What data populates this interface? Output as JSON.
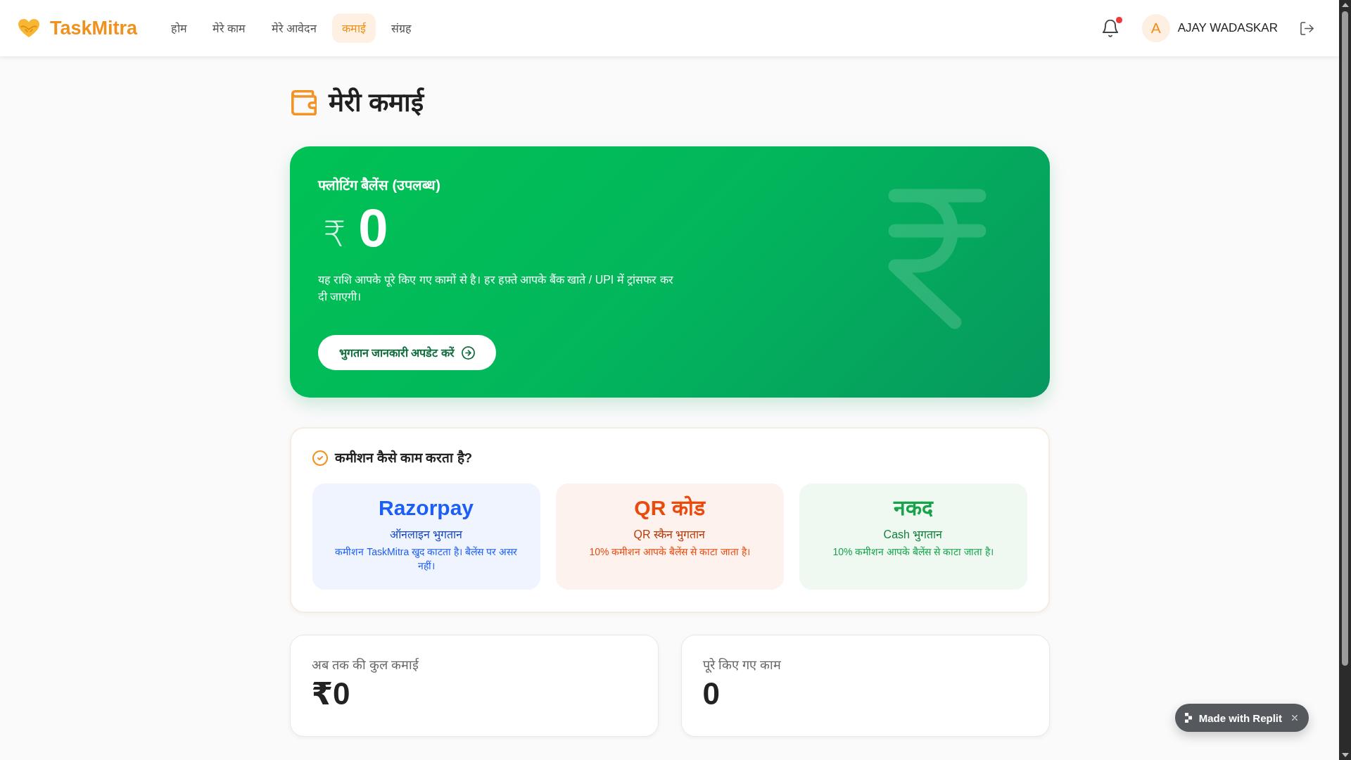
{
  "header": {
    "brand": "TaskMitra",
    "nav": [
      {
        "label": "होम",
        "selected": false
      },
      {
        "label": "मेरे काम",
        "selected": false
      },
      {
        "label": "मेरे आवेदन",
        "selected": false
      },
      {
        "label": "कमाई",
        "selected": true
      },
      {
        "label": "संग्रह",
        "selected": false
      }
    ],
    "notifications": {
      "unread": true
    },
    "user": {
      "initial": "A",
      "name": "AJAY WADASKAR"
    }
  },
  "page": {
    "title": "मेरी कमाई"
  },
  "balance_card": {
    "label": "फ्लोटिंग बैलेंस (उपलब्ध)",
    "currency": "₹",
    "amount": "0",
    "note": "यह राशि आपके पूरे किए गए कामों से है। हर हफ़्ते आपके बैंक खाते / UPI में ट्रांसफर कर दी जाएगी।",
    "button": "भुगतान जानकारी अपडेट करें"
  },
  "commission": {
    "title": "कमीशन कैसे काम करता है?",
    "methods": [
      {
        "name": "Razorpay",
        "mode": "ऑनलाइन भुगतान",
        "note": "कमीशन TaskMitra खुद काटता है। बैलेंस पर असर नहीं।",
        "color": "#1d5ef5"
      },
      {
        "name": "QR कोड",
        "mode": "QR स्कैन भुगतान",
        "note": "10% कमीशन आपके बैलेंस से काटा जाता है।",
        "color": "#ea4a0c"
      },
      {
        "name": "नकद",
        "mode": "Cash भुगतान",
        "note": "10% कमीशन आपके बैलेंस से काटा जाता है।",
        "color": "#16a34a"
      }
    ]
  },
  "stats": [
    {
      "label": "अब तक की कुल कमाई",
      "value": "₹0"
    },
    {
      "label": "पूरे किए गए काम",
      "value": "0"
    }
  ],
  "badge": {
    "label": "Made with Replit"
  }
}
